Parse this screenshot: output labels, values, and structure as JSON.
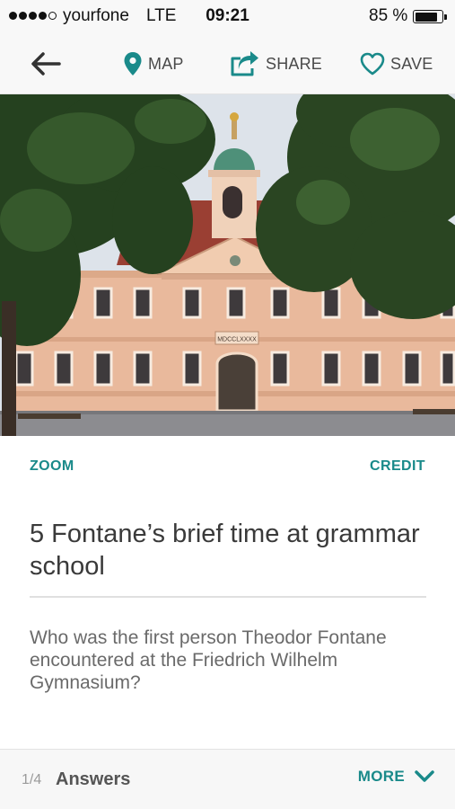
{
  "status_bar": {
    "carrier": "yourfone",
    "network": "LTE",
    "time": "09:21",
    "battery": "85 %",
    "battery_level": 0.85,
    "signal_bars_filled": 4,
    "signal_bars_total": 5
  },
  "toolbar": {
    "back_icon": "arrow-left-icon",
    "map_label": "MAP",
    "map_icon": "map-pin-icon",
    "share_label": "SHARE",
    "share_icon": "share-icon",
    "save_label": "SAVE",
    "save_icon": "heart-icon"
  },
  "hero": {
    "image_subject": "school building with clock tower between trees",
    "building_inscription": "MDCCLXXXX"
  },
  "links": {
    "zoom": "ZOOM",
    "credit": "CREDIT"
  },
  "content": {
    "title": "5 Fontane’s brief time at grammar school",
    "question": "Who was the first person Theodor Fontane encountered at the Friedrich Wilhelm Gymnasium?"
  },
  "footer": {
    "counter": "1/4",
    "answers_label": "Answers",
    "more_label": "MORE",
    "more_icon": "chevron-down-icon"
  },
  "colors": {
    "accent": "#1a8a8a",
    "text_dark": "#3a3a3a",
    "text_muted": "#6a6a6a",
    "bar_bg": "#f8f8f8"
  }
}
